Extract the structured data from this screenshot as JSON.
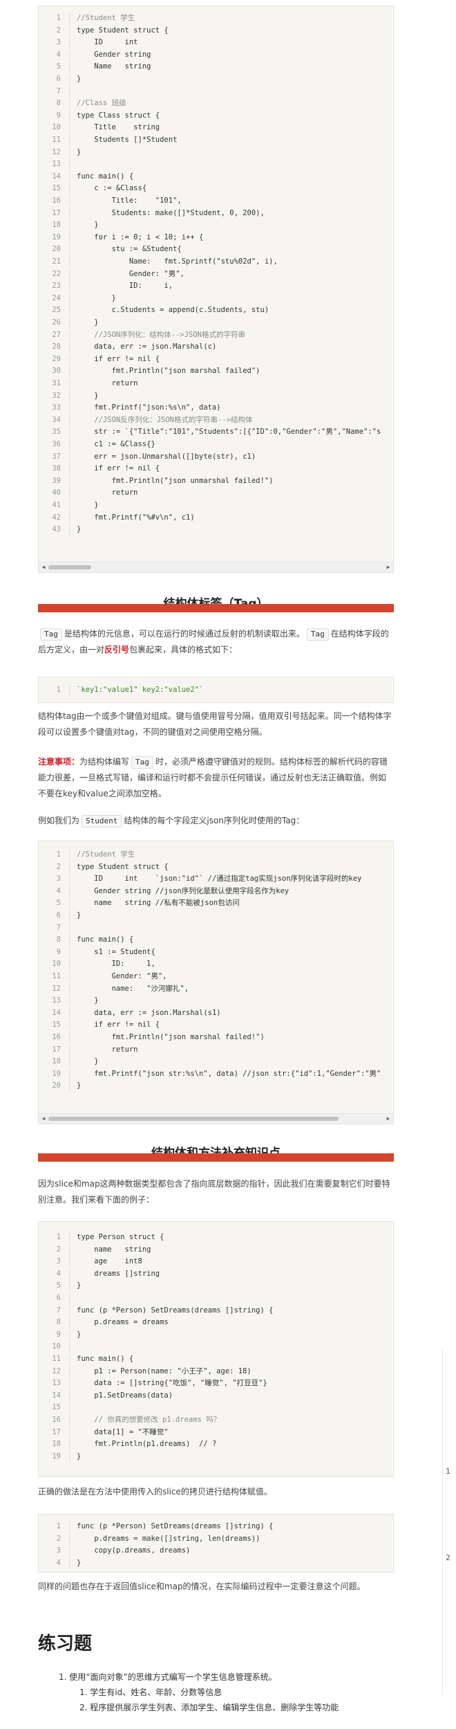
{
  "code1": {
    "lines": [
      "//Student 学生",
      "type Student struct {",
      "    ID     int",
      "    Gender string",
      "    Name   string",
      "}",
      "",
      "//Class 班级",
      "type Class struct {",
      "    Title    string",
      "    Students []*Student",
      "}",
      "",
      "func main() {",
      "    c := &Class{",
      "        Title:    \"101\",",
      "        Students: make([]*Student, 0, 200),",
      "    }",
      "    for i := 0; i < 10; i++ {",
      "        stu := &Student{",
      "            Name:   fmt.Sprintf(\"stu%02d\", i),",
      "            Gender: \"男\",",
      "            ID:     i,",
      "        }",
      "        c.Students = append(c.Students, stu)",
      "    }",
      "    //JSON序列化：结构体-->JSON格式的字符串",
      "    data, err := json.Marshal(c)",
      "    if err != nil {",
      "        fmt.Println(\"json marshal failed\")",
      "        return",
      "    }",
      "    fmt.Printf(\"json:%s\\n\", data)",
      "    //JSON反序列化：JSON格式的字符串-->结构体",
      "    str := `{\"Title\":\"101\",\"Students\":[{\"ID\":0,\"Gender\":\"男\",\"Name\":\"s",
      "    c1 := &Class{}",
      "    err = json.Unmarshal([]byte(str), c1)",
      "    if err != nil {",
      "        fmt.Println(\"json unmarshal failed!\")",
      "        return",
      "    }",
      "    fmt.Printf(\"%#v\\n\", c1)",
      "}"
    ]
  },
  "section_tag": {
    "heading": "结构体标签（Tag）",
    "p1_code": "Tag",
    "p1_a": "是结构体的元信息，可以在运行的时候通过反射的机制读取出来。",
    "p1_code2": "Tag",
    "p1_b": "在结构体字段的后方定义，由一对",
    "p1_red": "反引号",
    "p1_c": "包裹起来，具体的格式如下：",
    "code_line": "`key1:\"value1\" key2:\"value2\"`",
    "p2": "结构体tag由一个或多个键值对组成。键与值使用冒号分隔，值用双引号括起来。同一个结构体字段可以设置多个键值对tag，不同的键值对之间使用空格分隔。",
    "p3_red": "注意事项：",
    "p3_a": "为结构体编写",
    "p3_code": "Tag",
    "p3_b": "时，必须严格遵守键值对的规则。结构体标签的解析代码的容错能力很差，一旦格式写错，编译和运行时都不会提示任何错误，通过反射也无法正确取值。例如不要在key和value之间添加空格。",
    "p4_a": "例如我们为",
    "p4_code": "Student",
    "p4_b": "结构体的每个字段定义json序列化时使用的Tag："
  },
  "code2": {
    "lines": [
      "//Student 学生",
      "type Student struct {",
      "    ID     int    `json:\"id\"` //通过指定tag实现json序列化该字段时的key",
      "    Gender string //json序列化是默认使用字段名作为key",
      "    name   string //私有不能被json包访问",
      "}",
      "",
      "func main() {",
      "    s1 := Student{",
      "        ID:     1,",
      "        Gender: \"男\",",
      "        name:   \"沙河娜扎\",",
      "    }",
      "    data, err := json.Marshal(s1)",
      "    if err != nil {",
      "        fmt.Println(\"json marshal failed!\")",
      "        return",
      "    }",
      "    fmt.Printf(\"json str:%s\\n\", data) //json str:{\"id\":1,\"Gender\":\"男\"",
      "}"
    ]
  },
  "section_supp": {
    "heading": "结构体和方法补充知识点",
    "p1": "因为slice和map这两种数据类型都包含了指向底层数据的指针，因此我们在需要复制它们时要特别注意。我们来看下面的例子："
  },
  "code3": {
    "lines": [
      "type Person struct {",
      "    name   string",
      "    age    int8",
      "    dreams []string",
      "}",
      "",
      "func (p *Person) SetDreams(dreams []string) {",
      "    p.dreams = dreams",
      "}",
      "",
      "func main() {",
      "    p1 := Person(name: \"小王子\", age: 18)",
      "    data := []string{\"吃饭\", \"睡觉\", \"打豆豆\"}",
      "    p1.SetDreams(data)",
      "",
      "    // 你真的想要修改 p1.dreams 吗？",
      "    data[1] = \"不睡觉\"",
      "    fmt.Println(p1.dreams)  // ?",
      "}"
    ]
  },
  "para_correct": "正确的做法是在方法中使用传入的slice的拷贝进行结构体赋值。",
  "code4": {
    "lines": [
      "func (p *Person) SetDreams(dreams []string) {",
      "    p.dreams = make([]string, len(dreams))",
      "    copy(p.dreams, dreams)",
      "}"
    ]
  },
  "para_same": "同样的问题也存在于返回值slice和map的情况，在实际编码过程中一定要注意这个问题。",
  "exercise": {
    "heading": "练习题",
    "item1": "1. 使用“面向对象”的思维方式编写一个学生信息管理系统。",
    "sub1": "1. 学生有id、姓名、年龄、分数等信息",
    "sub2": "2. 程序提供展示学生列表、添加学生、编辑学生信息、删除学生等功能"
  },
  "side_markers": [
    "1",
    "2"
  ]
}
